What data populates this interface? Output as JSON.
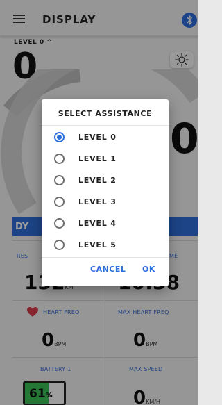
{
  "header": {
    "title": "DISPLAY",
    "menu_icon": "hamburger-menu-icon",
    "bluetooth_icon": "bluetooth-icon"
  },
  "dashboard": {
    "level_selector": "LEVEL 0 ^",
    "assist_digit": "0",
    "brightness_icon": "brightness-icon",
    "speed_digit": "0",
    "mode_bar_label": "DY",
    "cells": [
      {
        "label": "RES",
        "value": "132",
        "unit": "KM"
      },
      {
        "label": "ME",
        "value": "10:38",
        "unit": ""
      },
      {
        "label": "HEART FREQ",
        "value": "0",
        "unit": "BPM"
      },
      {
        "label": "MAX HEART FREQ",
        "value": "0",
        "unit": "BPM"
      },
      {
        "label": "BATTERY 1",
        "value": "61",
        "unit": "%"
      },
      {
        "label": "MAX SPEED",
        "value": "0",
        "unit": "KM/H"
      }
    ],
    "battery_level": 0.61,
    "colors": {
      "accent": "#2e6fd8",
      "battery_green": "#3cc157",
      "heart": "#d93a4a"
    }
  },
  "dialog": {
    "title": "SELECT ASSISTANCE",
    "options": [
      "LEVEL 0",
      "LEVEL 1",
      "LEVEL 2",
      "LEVEL 3",
      "LEVEL 4",
      "LEVEL 5"
    ],
    "selected_index": 0,
    "cancel_label": "CANCEL",
    "ok_label": "OK"
  }
}
